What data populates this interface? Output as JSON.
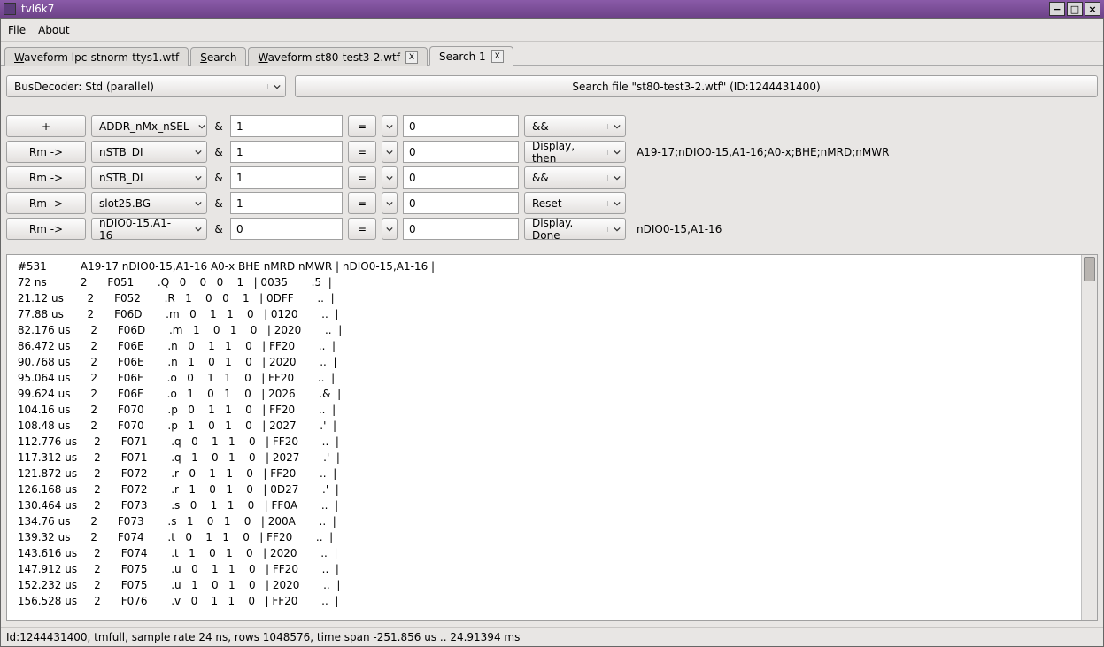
{
  "window": {
    "title": "tvl6k7"
  },
  "menu": {
    "file": "File",
    "about": "About"
  },
  "tabs": [
    {
      "label_pre": "W",
      "label_rest": "aveform lpc-stnorm-ttys1.wtf",
      "closable": false,
      "active": false
    },
    {
      "label_pre": "S",
      "label_rest": "earch",
      "closable": false,
      "active": false
    },
    {
      "label_pre": "W",
      "label_rest": "aveform st80-test3-2.wtf",
      "closable": true,
      "active": false
    },
    {
      "label_pre": "",
      "label_rest": "Search 1",
      "closable": true,
      "active": true
    }
  ],
  "decoder": {
    "label": "BusDecoder: Std (parallel)",
    "search_button": "Search file \"st80-test3-2.wtf\" (ID:1244431400)"
  },
  "filters": [
    {
      "first": "+",
      "signal": "ADDR_nMx_nSEL",
      "v1": "1",
      "eq": "=",
      "v2": "0",
      "action": "&&",
      "trail": ""
    },
    {
      "first": "Rm ->",
      "signal": "nSTB_DI",
      "v1": "1",
      "eq": "=",
      "v2": "0",
      "action": "Display, then",
      "trail": "A19-17;nDIO0-15,A1-16;A0-x;BHE;nMRD;nMWR"
    },
    {
      "first": "Rm ->",
      "signal": "nSTB_DI",
      "v1": "1",
      "eq": "=",
      "v2": "0",
      "action": "&&",
      "trail": ""
    },
    {
      "first": "Rm ->",
      "signal": "slot25.BG",
      "v1": "1",
      "eq": "=",
      "v2": "0",
      "action": "Reset",
      "trail": ""
    },
    {
      "first": "Rm ->",
      "signal": "nDIO0-15,A1-16",
      "v1": "0",
      "eq": "=",
      "v2": "0",
      "action": "Display. Done",
      "trail": "nDIO0-15,A1-16"
    }
  ],
  "amp_label": "&",
  "output_header": " #531          A19-17 nDIO0-15,A1-16 A0-x BHE nMRD nMWR | nDIO0-15,A1-16 |",
  "output_rows": [
    " 72 ns          2      F051       .Q   0    0   0    1   | 0035       .5  |",
    " 21.12 us       2      F052       .R   1    0   0    1   | 0DFF       ..  |",
    " 77.88 us       2      F06D       .m   0    1   1    0   | 0120       ..  |",
    " 82.176 us      2      F06D       .m   1    0   1    0   | 2020       ..  |",
    " 86.472 us      2      F06E       .n   0    1   1    0   | FF20       ..  |",
    " 90.768 us      2      F06E       .n   1    0   1    0   | 2020       ..  |",
    " 95.064 us      2      F06F       .o   0    1   1    0   | FF20       ..  |",
    " 99.624 us      2      F06F       .o   1    0   1    0   | 2026       .&  |",
    " 104.16 us      2      F070       .p   0    1   1    0   | FF20       ..  |",
    " 108.48 us      2      F070       .p   1    0   1    0   | 2027       .'  |",
    " 112.776 us     2      F071       .q   0    1   1    0   | FF20       ..  |",
    " 117.312 us     2      F071       .q   1    0   1    0   | 2027       .'  |",
    " 121.872 us     2      F072       .r   0    1   1    0   | FF20       ..  |",
    " 126.168 us     2      F072       .r   1    0   1    0   | 0D27       .'  |",
    " 130.464 us     2      F073       .s   0    1   1    0   | FF0A       ..  |",
    " 134.76 us      2      F073       .s   1    0   1    0   | 200A       ..  |",
    " 139.32 us      2      F074       .t   0    1   1    0   | FF20       ..  |",
    " 143.616 us     2      F074       .t   1    0   1    0   | 2020       ..  |",
    " 147.912 us     2      F075       .u   0    1   1    0   | FF20       ..  |",
    " 152.232 us     2      F075       .u   1    0   1    0   | 2020       ..  |",
    " 156.528 us     2      F076       .v   0    1   1    0   | FF20       ..  |"
  ],
  "statusbar": "Id:1244431400, tmfull, sample rate 24 ns, rows 1048576, time span -251.856 us .. 24.91394 ms"
}
